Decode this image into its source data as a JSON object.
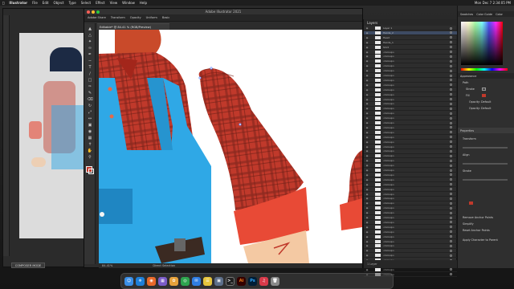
{
  "menubar": {
    "app_name": "Illustrator",
    "items": [
      "File",
      "Edit",
      "Object",
      "Type",
      "Select",
      "Effect",
      "View",
      "Window",
      "Help"
    ],
    "clock": "Mon Dec 7  2:34:05 PM"
  },
  "window": {
    "title": "Adobe Illustrator 2021",
    "doc_tab": "Editable* @ 84.41 % (RGB/Preview)",
    "control_bar": [
      "Adobe Share",
      "Transform",
      "Opacity",
      "Uniform",
      "Basic"
    ],
    "status_zoom": "84.41%",
    "status_label": "Direct Selection"
  },
  "layers_panel": {
    "title": "Layers",
    "top_rows": [
      "Layer 1",
      "Hands_2",
      "Head",
      "Hands_1",
      "Shirt"
    ],
    "repeated_label": "<Group>",
    "repeat_count": 48,
    "footer": "1 Layer"
  },
  "right_panels": {
    "tabs_top": [
      "Swatches",
      "Color Guide",
      "Color"
    ],
    "appearance": {
      "title": "Appearance",
      "items": [
        "Path",
        "Stroke",
        "Fill",
        "Opacity: Default",
        "Opacity: Default"
      ],
      "fill_color": "#c0392b"
    },
    "properties": {
      "title": "Properties",
      "lines": [
        "Transform",
        "Align",
        "Stroke",
        "Remove Anchor Points",
        "Simplify",
        "Reset Anchor Points",
        "Apply Character to Parent"
      ]
    }
  },
  "composer_badge": "COMPOSER MODE",
  "dock": {
    "apps": [
      "Finder",
      "Safari",
      "Firefox",
      "Launchpad",
      "Photos",
      "Chrome",
      "Mail",
      "Notes",
      "Preview",
      "Terminal",
      "Ai",
      "Ps",
      "Music",
      "Trash"
    ]
  },
  "colors": {
    "plaid_red": "#c0392b",
    "overalls_blue": "#2fa8e6",
    "cuff_red": "#e84a36",
    "skin": "#f4c9a3",
    "ui_dark": "#2c2c2c",
    "dock_ps": "#2b6bd4",
    "dock_ai": "#f07d1b"
  }
}
